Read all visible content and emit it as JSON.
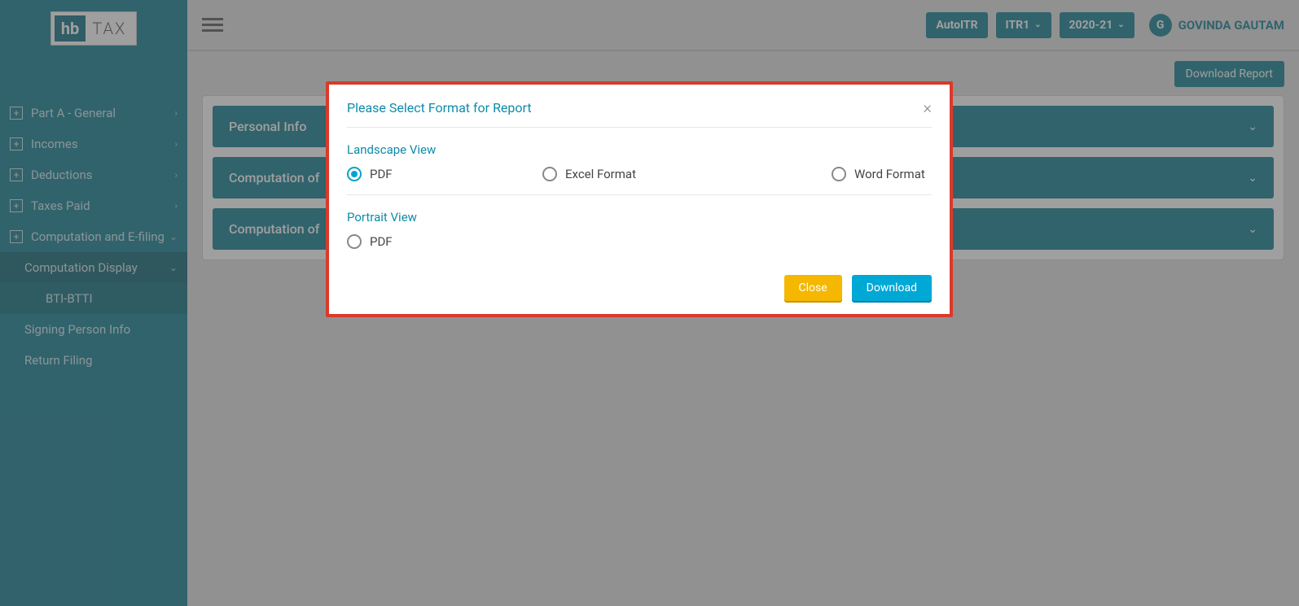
{
  "logo": {
    "hb": "hb",
    "tax": "TAX"
  },
  "sidebar": {
    "items": [
      {
        "label": "Part A - General",
        "icon": "plus",
        "chev": "right"
      },
      {
        "label": "Incomes",
        "icon": "plus",
        "chev": "right"
      },
      {
        "label": "Deductions",
        "icon": "plus",
        "chev": "right"
      },
      {
        "label": "Taxes Paid",
        "icon": "plus",
        "chev": "right"
      },
      {
        "label": "Computation and E-filing",
        "icon": "plus",
        "chev": "down"
      }
    ],
    "sub": [
      {
        "label": "Computation Display",
        "chev": "down",
        "active": true
      },
      {
        "label": "BTI-BTTI",
        "sub": true
      }
    ],
    "rest": [
      {
        "label": "Signing Person Info"
      },
      {
        "label": "Return Filing"
      }
    ]
  },
  "topbar": {
    "autoitr": "AutoITR",
    "itr": "ITR1",
    "year": "2020-21",
    "user_initial": "G",
    "user_name": "GOVINDA GAUTAM"
  },
  "content": {
    "download_report": "Download Report",
    "accordions": [
      "Personal Info",
      "Computation of",
      "Computation of"
    ]
  },
  "modal": {
    "title": "Please Select Format for Report",
    "landscape_title": "Landscape View",
    "landscape_options": [
      {
        "label": "PDF",
        "selected": true
      },
      {
        "label": "Excel Format",
        "selected": false
      },
      {
        "label": "Word Format",
        "selected": false
      }
    ],
    "portrait_title": "Portrait View",
    "portrait_options": [
      {
        "label": "PDF",
        "selected": false
      }
    ],
    "close_btn": "Close",
    "download_btn": "Download"
  }
}
